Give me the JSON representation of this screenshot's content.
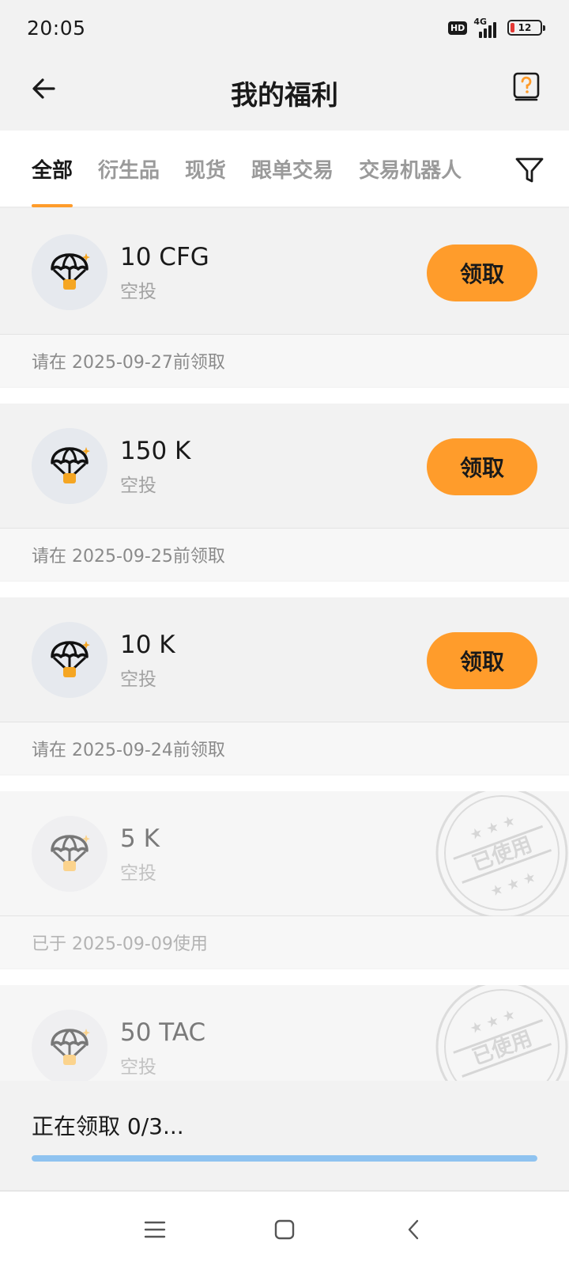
{
  "status_bar": {
    "time": "20:05",
    "hd_badge": "HD",
    "network": "4G",
    "battery_level": "12",
    "battery_color": "#e53935"
  },
  "header": {
    "title": "我的福利",
    "back_icon": "arrow-left-icon",
    "help_icon": "help-book-icon"
  },
  "tabs": {
    "items": [
      {
        "label": "全部",
        "active": true
      },
      {
        "label": "衍生品",
        "active": false
      },
      {
        "label": "现货",
        "active": false
      },
      {
        "label": "跟单交易",
        "active": false
      },
      {
        "label": "交易机器人",
        "active": false
      }
    ],
    "filter_icon": "filter-funnel-icon"
  },
  "rewards": [
    {
      "amount": "10 CFG",
      "type": "空投",
      "footer": "请在 2025-09-27前领取",
      "button": "领取",
      "used": false
    },
    {
      "amount": "150 K",
      "type": "空投",
      "footer": "请在 2025-09-25前领取",
      "button": "领取",
      "used": false
    },
    {
      "amount": "10 K",
      "type": "空投",
      "footer": "请在 2025-09-24前领取",
      "button": "领取",
      "used": false
    },
    {
      "amount": "5 K",
      "type": "空投",
      "footer": "已于 2025-09-09使用",
      "stamp": "已使用",
      "used": true
    },
    {
      "amount": "50 TAC",
      "type": "空投",
      "stamp": "已使用",
      "used": true
    }
  ],
  "progress": {
    "text": "正在领取 0/3...",
    "fraction": 1.0
  },
  "nav": {
    "menu_icon": "menu-icon",
    "home_icon": "home-square-icon",
    "back_icon": "back-chevron-icon"
  },
  "colors": {
    "accent": "#ff9c2b",
    "progress": "#8fc3f0"
  }
}
